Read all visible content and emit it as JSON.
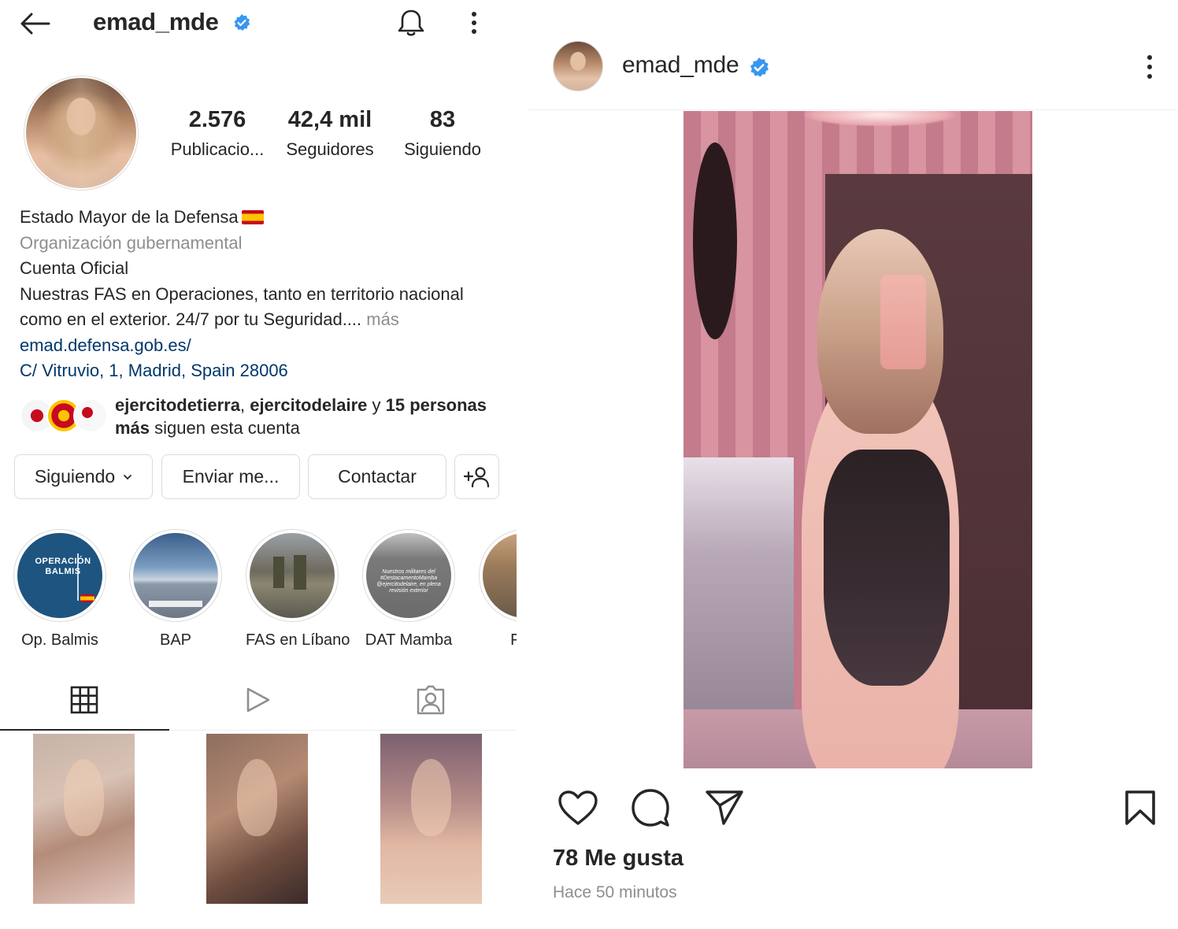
{
  "profile": {
    "username": "emad_mde",
    "verified": true,
    "stats": {
      "posts_count": "2.576",
      "posts_label": "Publicacio...",
      "followers_count": "42,4 mil",
      "followers_label": "Seguidores",
      "following_count": "83",
      "following_label": "Siguiendo"
    },
    "bio": {
      "name": "Estado Mayor de la Defensa",
      "category": "Organización gubernamental",
      "line1": "Cuenta Oficial",
      "line2": "Nuestras FAS en Operaciones, tanto en territorio nacional",
      "line3": "como en el exterior. 24/7 por tu Seguridad....",
      "more": " más",
      "link": "emad.defensa.gob.es/",
      "address": "C/ Vitruvio, 1, Madrid, Spain 28006"
    },
    "followed_by": {
      "name1": "ejercitodetierra",
      "sep1": ", ",
      "name2": "ejercitodelaire",
      "conj": " y ",
      "count": "15 personas",
      "line2_bold": "más",
      "line2_rest": " siguen esta cuenta"
    },
    "buttons": {
      "following": "Siguiendo",
      "message": "Enviar me...",
      "contact": "Contactar"
    },
    "highlights": [
      {
        "label": "Op. Balmis",
        "cover_text": "OPERACIÓN BALMIS"
      },
      {
        "label": "BAP"
      },
      {
        "label": "FAS en Líbano"
      },
      {
        "label": "DAT Mamba",
        "cover_text": "Nuestros militares del #DestacamentoMamba @ejercitodelaire, en plena revisión exterior"
      },
      {
        "label": "FAS"
      }
    ],
    "tabs": [
      "grid",
      "reels",
      "tagged"
    ],
    "active_tab": "grid"
  },
  "post": {
    "username": "emad_mde",
    "verified": true,
    "likes": "78 Me gusta",
    "timestamp": "Hace 50 minutos"
  },
  "colors": {
    "verified_blue": "#3897f0",
    "link": "#00376b",
    "secondary_text": "#8e8e8e",
    "border": "#dbdbdb"
  },
  "icons": {
    "back": "arrow-left-icon",
    "notifications": "bell-icon",
    "more": "more-vertical-icon",
    "add_user": "add-user-icon",
    "grid": "grid-icon",
    "reels": "reels-icon",
    "tagged": "tagged-icon",
    "like": "heart-icon",
    "comment": "comment-icon",
    "share": "send-icon",
    "save": "bookmark-icon"
  }
}
